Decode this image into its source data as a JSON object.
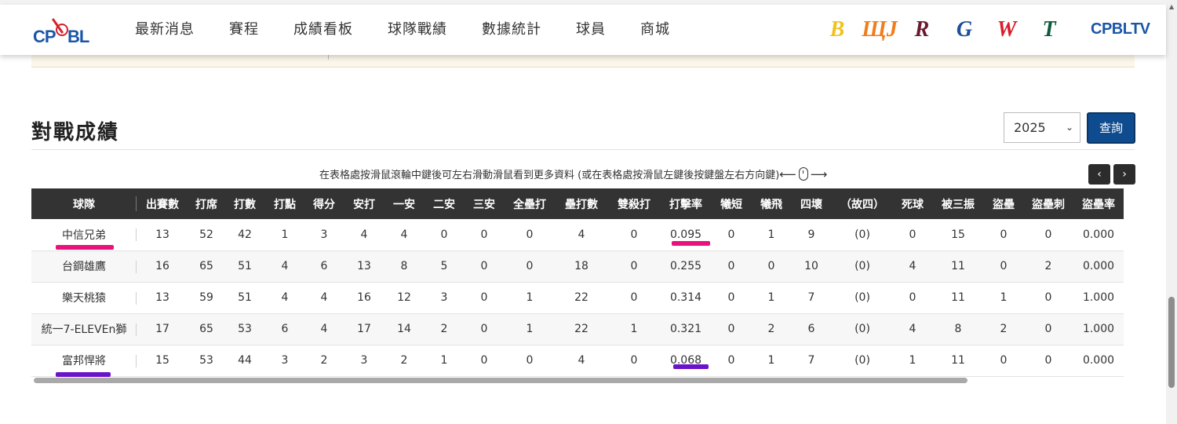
{
  "header": {
    "logo": {
      "cp": "CP",
      "bl": "BL"
    },
    "nav": [
      "最新消息",
      "賽程",
      "成績看板",
      "球隊戰績",
      "數據統計",
      "球員",
      "商城"
    ],
    "team_logos": [
      {
        "name": "brothers-logo",
        "glyph": "B",
        "color": "#f2c21b"
      },
      {
        "name": "lions-logo",
        "glyph": "ЩJ",
        "color": "#f07d1a"
      },
      {
        "name": "monkeys-logo",
        "glyph": "R",
        "color": "#6b1a2e"
      },
      {
        "name": "guardians-logo",
        "glyph": "G",
        "color": "#1c4f9c"
      },
      {
        "name": "wildwing-logo",
        "glyph": "W",
        "color": "#d81e2a"
      },
      {
        "name": "hawks-logo",
        "glyph": "T",
        "color": "#0e5a3a"
      }
    ],
    "tv_label": "CPBLTV"
  },
  "section": {
    "title": "對戰成績",
    "year_selected": "2025",
    "query_label": "查詢",
    "hint": "在表格處按滑鼠滾輪中鍵後可左右滑動滑鼠看到更多資料 (或在表格處按滑鼠左鍵後按鍵盤左右方向鍵)"
  },
  "table": {
    "columns": [
      "球隊",
      "出賽數",
      "打席",
      "打數",
      "打點",
      "得分",
      "安打",
      "一安",
      "二安",
      "三安",
      "全壘打",
      "壘打數",
      "雙殺打",
      "打擊率",
      "犧短",
      "犧飛",
      "四壞",
      "（故四）",
      "死球",
      "被三振",
      "盜壘",
      "盜壘刺",
      "盜壘率"
    ],
    "rows": [
      [
        "中信兄弟",
        "13",
        "52",
        "42",
        "1",
        "3",
        "4",
        "4",
        "0",
        "0",
        "0",
        "4",
        "0",
        "0.095",
        "0",
        "1",
        "9",
        "(0)",
        "0",
        "15",
        "0",
        "0",
        "0.000"
      ],
      [
        "台鋼雄鷹",
        "16",
        "65",
        "51",
        "4",
        "6",
        "13",
        "8",
        "5",
        "0",
        "0",
        "18",
        "0",
        "0.255",
        "0",
        "0",
        "10",
        "(0)",
        "4",
        "11",
        "0",
        "2",
        "0.000"
      ],
      [
        "樂天桃猿",
        "13",
        "59",
        "51",
        "4",
        "4",
        "16",
        "12",
        "3",
        "0",
        "1",
        "22",
        "0",
        "0.314",
        "0",
        "1",
        "7",
        "(0)",
        "0",
        "11",
        "1",
        "0",
        "1.000"
      ],
      [
        "統一7-ELEVEn獅",
        "17",
        "65",
        "53",
        "6",
        "4",
        "17",
        "14",
        "2",
        "0",
        "1",
        "22",
        "1",
        "0.321",
        "0",
        "2",
        "6",
        "(0)",
        "4",
        "8",
        "2",
        "0",
        "1.000"
      ],
      [
        "富邦悍將",
        "15",
        "53",
        "44",
        "3",
        "2",
        "3",
        "2",
        "1",
        "0",
        "0",
        "4",
        "0",
        "0.068",
        "0",
        "1",
        "7",
        "(0)",
        "1",
        "11",
        "0",
        "0",
        "0.000"
      ]
    ]
  },
  "annotations": {
    "pink": "#e8127c",
    "purple": "#6a14c9"
  }
}
